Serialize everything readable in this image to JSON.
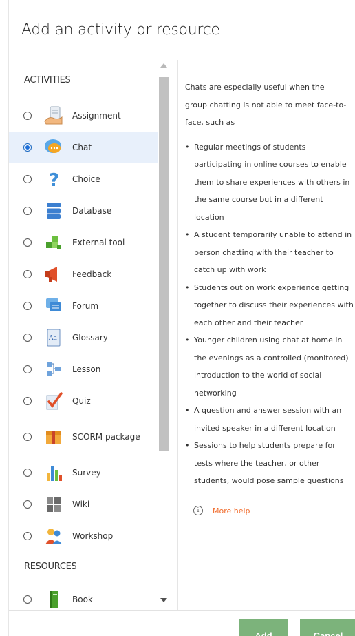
{
  "dialog": {
    "title": "Add an activity or resource"
  },
  "activities": {
    "heading": "ACTIVITIES",
    "items": [
      {
        "label": "Assignment",
        "icon": "assignment-icon",
        "selected": false
      },
      {
        "label": "Chat",
        "icon": "chat-icon",
        "selected": true
      },
      {
        "label": "Choice",
        "icon": "choice-icon",
        "selected": false
      },
      {
        "label": "Database",
        "icon": "database-icon",
        "selected": false
      },
      {
        "label": "External tool",
        "icon": "external-tool-icon",
        "selected": false
      },
      {
        "label": "Feedback",
        "icon": "feedback-icon",
        "selected": false
      },
      {
        "label": "Forum",
        "icon": "forum-icon",
        "selected": false
      },
      {
        "label": "Glossary",
        "icon": "glossary-icon",
        "selected": false
      },
      {
        "label": "Lesson",
        "icon": "lesson-icon",
        "selected": false
      },
      {
        "label": "Quiz",
        "icon": "quiz-icon",
        "selected": false
      },
      {
        "label": "SCORM package",
        "icon": "scorm-package-icon",
        "selected": false
      },
      {
        "label": "Survey",
        "icon": "survey-icon",
        "selected": false
      },
      {
        "label": "Wiki",
        "icon": "wiki-icon",
        "selected": false
      },
      {
        "label": "Workshop",
        "icon": "workshop-icon",
        "selected": false
      }
    ]
  },
  "resources": {
    "heading": "RESOURCES",
    "items": [
      {
        "label": "Book",
        "icon": "book-icon",
        "selected": false
      }
    ]
  },
  "help": {
    "intro": "Chats are especially useful when the group chatting is not able to meet face-to-face, such as",
    "bullets": [
      "Regular meetings of students participating in online courses to enable them to share experiences with others in the same course but in a different location",
      "A student temporarily unable to attend in person chatting with their teacher to catch up with work",
      "Students out on work experience getting together to discuss their experiences with each other and their teacher",
      "Younger children using chat at home in the evenings as a controlled (monitored) introduction to the world of social networking",
      "A question and answer session with an invited speaker in a different location",
      "Sessions to help students prepare for tests where the teacher, or other students, would pose sample questions"
    ],
    "more_help": "More help"
  },
  "footer": {
    "add": "Add",
    "cancel": "Cancel"
  },
  "colors": {
    "accent_button": "#7cb37b",
    "link": "#f06a2a",
    "selected_row": "#e8f0fb"
  }
}
